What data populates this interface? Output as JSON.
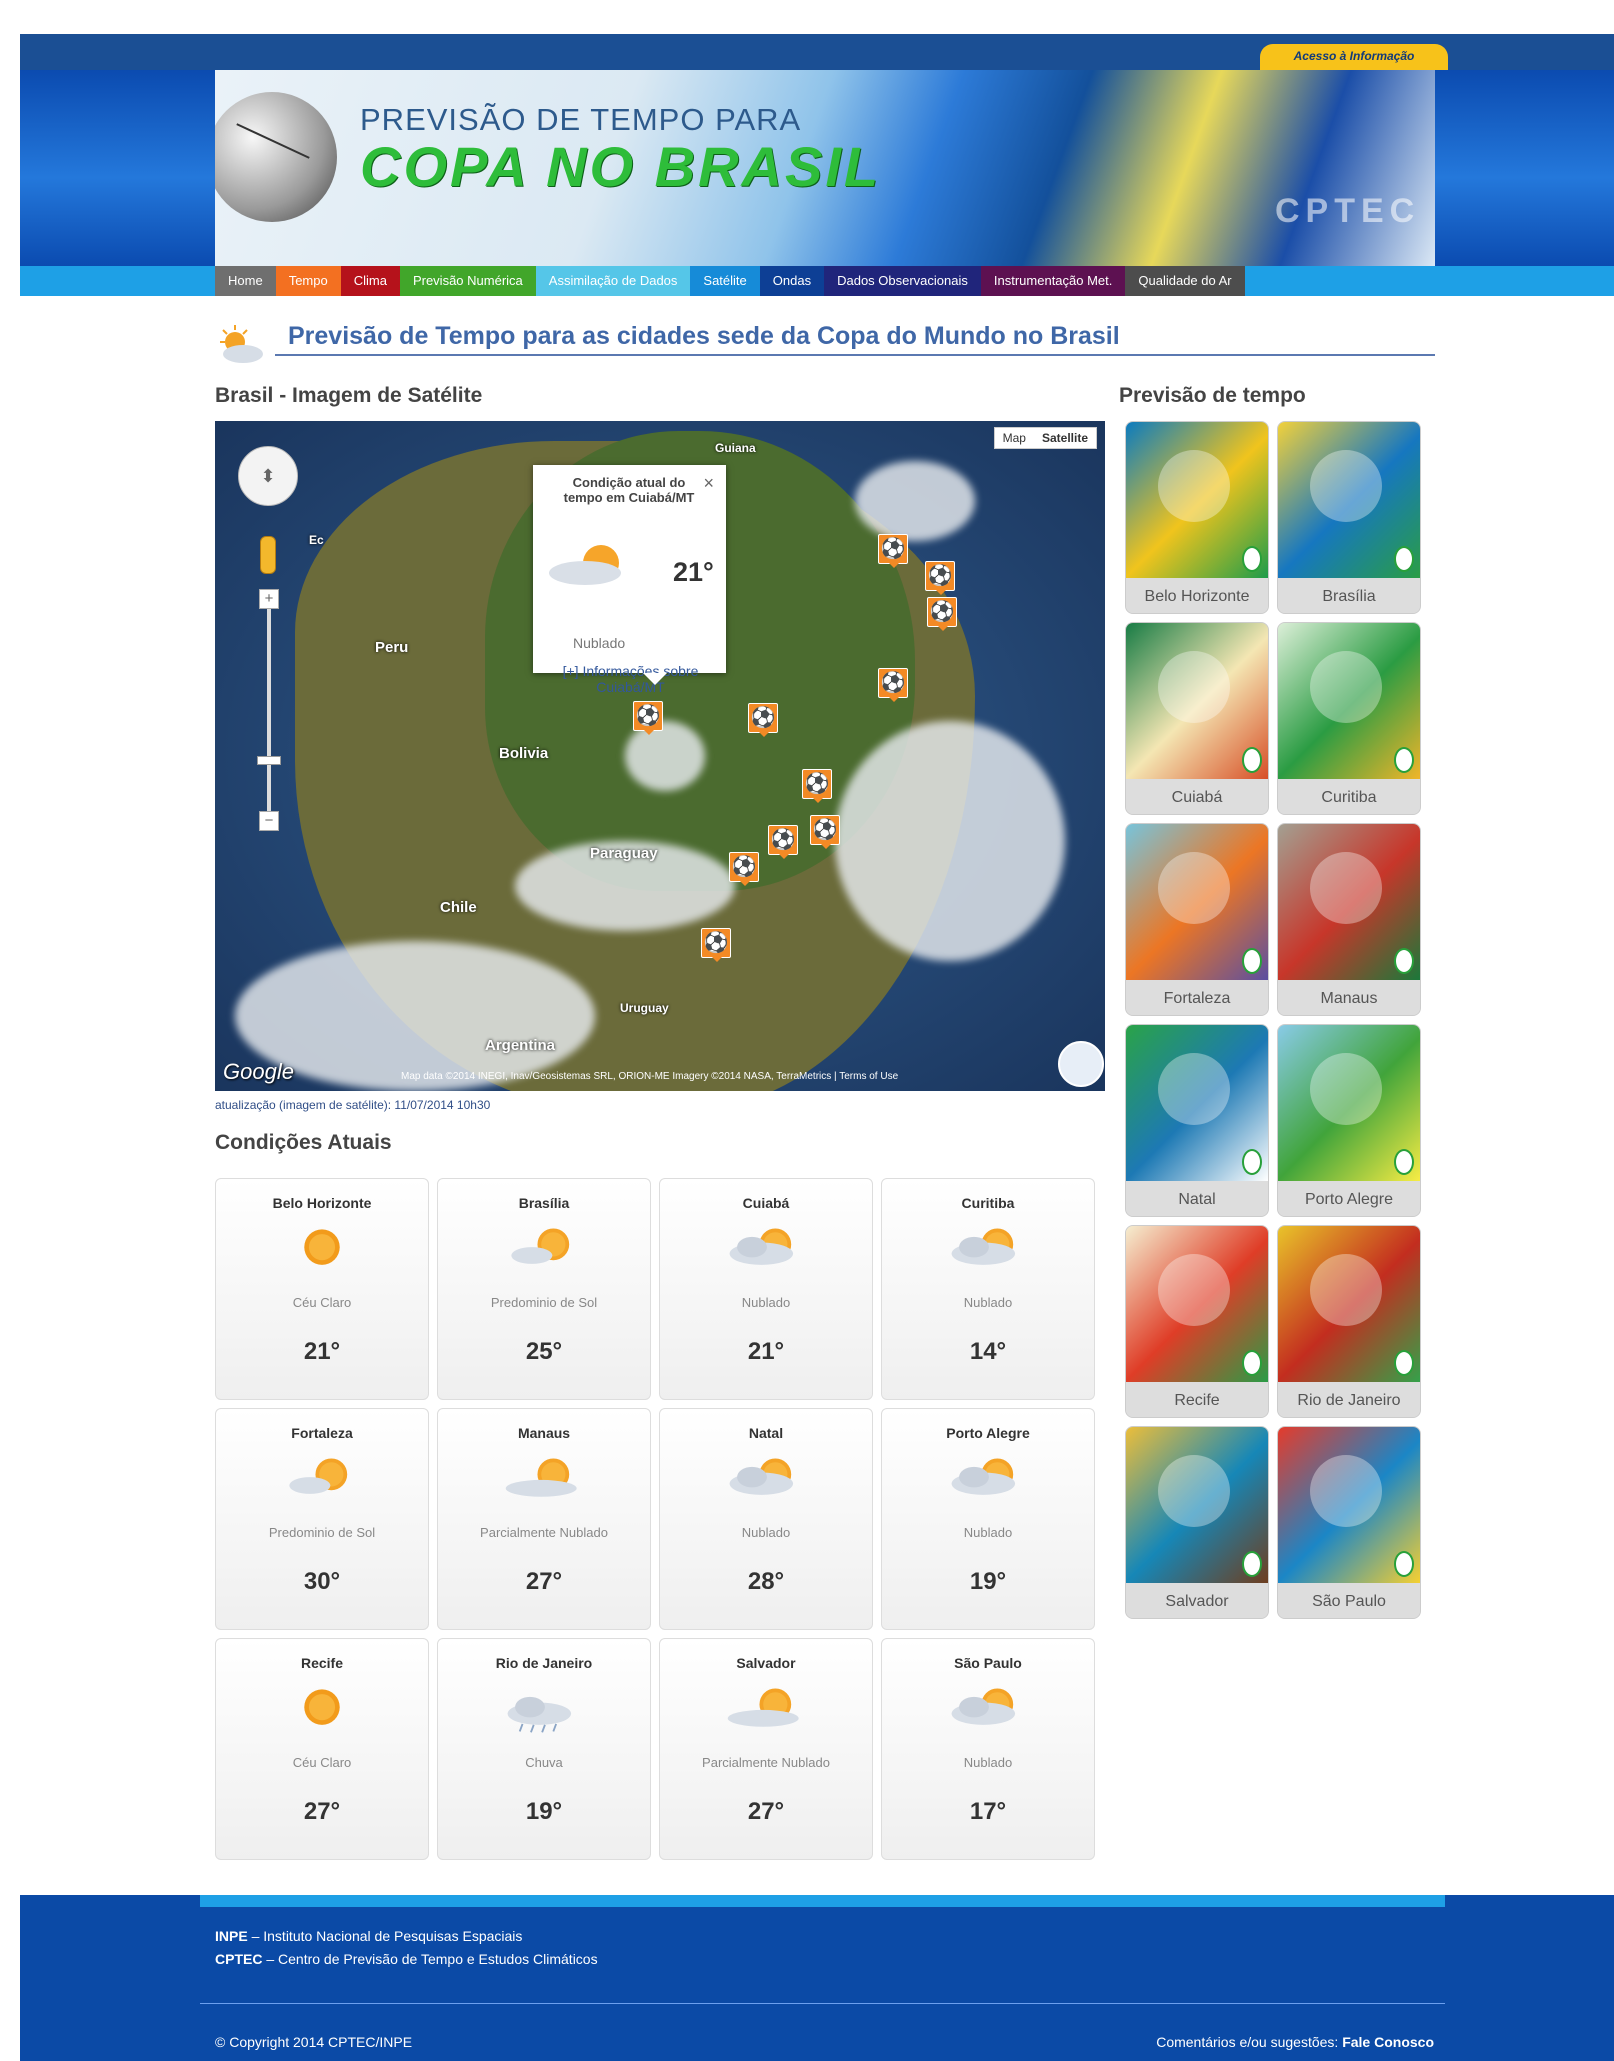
{
  "header": {
    "access_label": "Acesso à Informação",
    "title_line1": "PREVISÃO DE TEMPO PARA",
    "title_line2": "COPA NO BRASIL",
    "flags": [
      "flag-brazil",
      "flag-usa",
      "flag-spain"
    ],
    "watermark": "CPTEC"
  },
  "nav": [
    {
      "label": "Home",
      "color": "#6f6f6f"
    },
    {
      "label": "Tempo",
      "color": "#f37021"
    },
    {
      "label": "Clima",
      "color": "#b5121b"
    },
    {
      "label": "Previsão Numérica",
      "color": "#41a62a"
    },
    {
      "label": "Assimilação de Dados",
      "color": "#55c6e8"
    },
    {
      "label": "Satélite",
      "color": "#168bd8"
    },
    {
      "label": "Ondas",
      "color": "#0d3f95"
    },
    {
      "label": "Dados Observacionais",
      "color": "#20257b"
    },
    {
      "label": "Instrumentação Met.",
      "color": "#5d1151"
    },
    {
      "label": "Qualidade do Ar",
      "color": "#4d4d4d"
    }
  ],
  "page_title": "Previsão de Tempo para as cidades sede da Copa do Mundo no Brasil",
  "satellite_section": {
    "title": "Brasil - Imagem de Satélite",
    "map_button": "Map",
    "satellite_button": "Satellite",
    "labels": [
      "Peru",
      "Bolivia",
      "Paraguay",
      "Chile",
      "Uruguay",
      "Argentina",
      "Ec",
      "Guiana"
    ],
    "popup": {
      "title": "Condição atual do tempo em Cuiabá/MT",
      "temperature": "21°",
      "condition": "Nublado",
      "link": "[+] Informações sobre Cuiabá/MT"
    },
    "attribution": "Map data ©2014 INEGI, Inav/Geosistemas SRL, ORION-ME Imagery ©2014 NASA, TerraMetrics | Terms of Use",
    "google_logo": "Google",
    "update": "atualização (imagem de satélite): 11/07/2014 10h30"
  },
  "current_conditions": {
    "title": "Condições Atuais",
    "cities": [
      {
        "name": "Belo Horizonte",
        "condition": "Céu Claro",
        "temp": "21°",
        "icon": "sun-icon"
      },
      {
        "name": "Brasília",
        "condition": "Predominio de Sol",
        "temp": "25°",
        "icon": "mostly-sunny-icon"
      },
      {
        "name": "Cuiabá",
        "condition": "Nublado",
        "temp": "21°",
        "icon": "cloudy-icon"
      },
      {
        "name": "Curitiba",
        "condition": "Nublado",
        "temp": "14°",
        "icon": "cloudy-icon"
      },
      {
        "name": "Fortaleza",
        "condition": "Predominio de Sol",
        "temp": "30°",
        "icon": "mostly-sunny-icon"
      },
      {
        "name": "Manaus",
        "condition": "Parcialmente Nublado",
        "temp": "27°",
        "icon": "partly-cloudy-icon"
      },
      {
        "name": "Natal",
        "condition": "Nublado",
        "temp": "28°",
        "icon": "cloudy-icon"
      },
      {
        "name": "Porto Alegre",
        "condition": "Nublado",
        "temp": "19°",
        "icon": "cloudy-icon"
      },
      {
        "name": "Recife",
        "condition": "Céu Claro",
        "temp": "27°",
        "icon": "sun-icon"
      },
      {
        "name": "Rio de Janeiro",
        "condition": "Chuva",
        "temp": "19°",
        "icon": "rain-icon"
      },
      {
        "name": "Salvador",
        "condition": "Parcialmente Nublado",
        "temp": "27°",
        "icon": "partly-cloudy-icon"
      },
      {
        "name": "São Paulo",
        "condition": "Nublado",
        "temp": "17°",
        "icon": "cloudy-icon"
      }
    ]
  },
  "forecast_section": {
    "title": "Previsão de tempo",
    "cities": [
      {
        "name": "Belo Horizonte",
        "palette": [
          "#0b7bbf",
          "#f0c41d",
          "#1e9c4a"
        ]
      },
      {
        "name": "Brasília",
        "palette": [
          "#f2d13b",
          "#1677c0",
          "#2a9d45"
        ]
      },
      {
        "name": "Cuiabá",
        "palette": [
          "#187c45",
          "#f4e6b3",
          "#d74f27"
        ]
      },
      {
        "name": "Curitiba",
        "palette": [
          "#dcefd8",
          "#2b9c43",
          "#f0b52a"
        ]
      },
      {
        "name": "Fortaleza",
        "palette": [
          "#77c4db",
          "#ec7624",
          "#5b4fa0"
        ]
      },
      {
        "name": "Manaus",
        "palette": [
          "#a3a092",
          "#c7362a",
          "#1b783a"
        ]
      },
      {
        "name": "Natal",
        "palette": [
          "#2aa348",
          "#1d79b4",
          "#ffffff"
        ]
      },
      {
        "name": "Porto Alegre",
        "palette": [
          "#89cbe7",
          "#41a43b",
          "#f7ec45"
        ]
      },
      {
        "name": "Recife",
        "palette": [
          "#f5eed0",
          "#df3d27",
          "#2a9b46"
        ]
      },
      {
        "name": "Rio de Janeiro",
        "palette": [
          "#e9c32a",
          "#c32d1f",
          "#34a14a"
        ]
      },
      {
        "name": "Salvador",
        "palette": [
          "#ecbe3a",
          "#1687b7",
          "#6e3e1f"
        ]
      },
      {
        "name": "São Paulo",
        "palette": [
          "#e53b2b",
          "#1b86c6",
          "#f5d031"
        ]
      }
    ]
  },
  "footer": {
    "inpe_abbr": "INPE",
    "inpe_text": " – Instituto Nacional de Pesquisas Espaciais",
    "cptec_abbr": "CPTEC",
    "cptec_text": " – Centro de Previsão de Tempo e Estudos Climáticos",
    "copyright": "© Copyright 2014 CPTEC/INPE",
    "comments": "Comentários e/ou sugestões: ",
    "contact": "Fale Conosco"
  }
}
